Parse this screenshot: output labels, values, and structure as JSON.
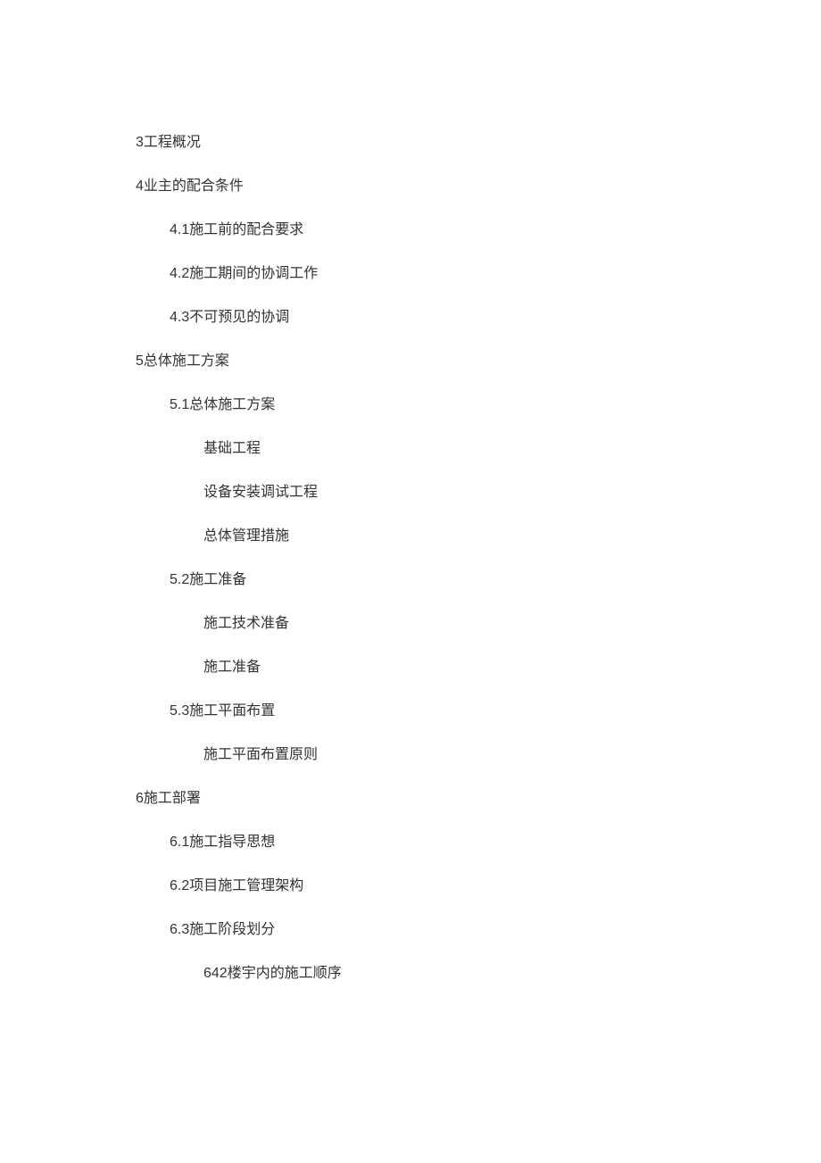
{
  "toc": [
    {
      "level": 0,
      "text": "3工程概况"
    },
    {
      "level": 0,
      "text": "4业主的配合条件"
    },
    {
      "level": 1,
      "text": "4.1施工前的配合要求"
    },
    {
      "level": 1,
      "text": "4.2施工期间的协调工作"
    },
    {
      "level": 1,
      "text": "4.3不可预见的协调"
    },
    {
      "level": 0,
      "text": "5总体施工方案"
    },
    {
      "level": 1,
      "text": "5.1总体施工方案"
    },
    {
      "level": 2,
      "text": "基础工程"
    },
    {
      "level": 2,
      "text": "设备安装调试工程"
    },
    {
      "level": 2,
      "text": "总体管理措施"
    },
    {
      "level": 1,
      "text": "5.2施工准备"
    },
    {
      "level": 2,
      "text": "施工技术准备"
    },
    {
      "level": 2,
      "text": "施工准备"
    },
    {
      "level": 1,
      "text": "5.3施工平面布置"
    },
    {
      "level": 2,
      "text": "施工平面布置原则"
    },
    {
      "level": 0,
      "text": "6施工部署"
    },
    {
      "level": 1,
      "text": "6.1施工指导思想"
    },
    {
      "level": 1,
      "text": "6.2项目施工管理架构"
    },
    {
      "level": 1,
      "text": "6.3施工阶段划分"
    },
    {
      "level": 2,
      "text": "642楼宇内的施工顺序"
    }
  ]
}
